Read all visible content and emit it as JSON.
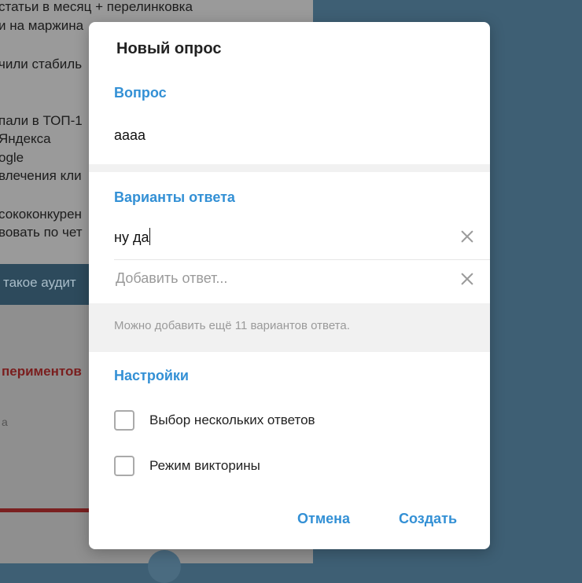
{
  "background": {
    "lines": [
      "статьи в месяц + перелинковка",
      "и на маржина",
      "",
      "чили стабиль",
      "",
      "",
      "пали в ТОП-1",
      "Яндекса",
      "ogle",
      "влечения кли",
      "",
      "сококонкурен",
      "вовать по чет"
    ],
    "bar_text": "такое аудит",
    "red_text": "периментов",
    "small_text": "а"
  },
  "dialog": {
    "title": "Новый опрос",
    "question_label": "Вопрос",
    "question_value": "аааа",
    "options_label": "Варианты ответа",
    "options": [
      {
        "value": "ну да"
      }
    ],
    "add_option_placeholder": "Добавить ответ...",
    "hint": "Можно добавить ещё 11 вариантов ответа.",
    "settings_label": "Настройки",
    "settings": [
      {
        "label": "Выбор нескольких ответов",
        "checked": false
      },
      {
        "label": "Режим викторины",
        "checked": false
      }
    ],
    "cancel_label": "Отмена",
    "create_label": "Создать"
  },
  "colors": {
    "accent": "#3390d5",
    "overlay_background": "#3e5f74"
  }
}
